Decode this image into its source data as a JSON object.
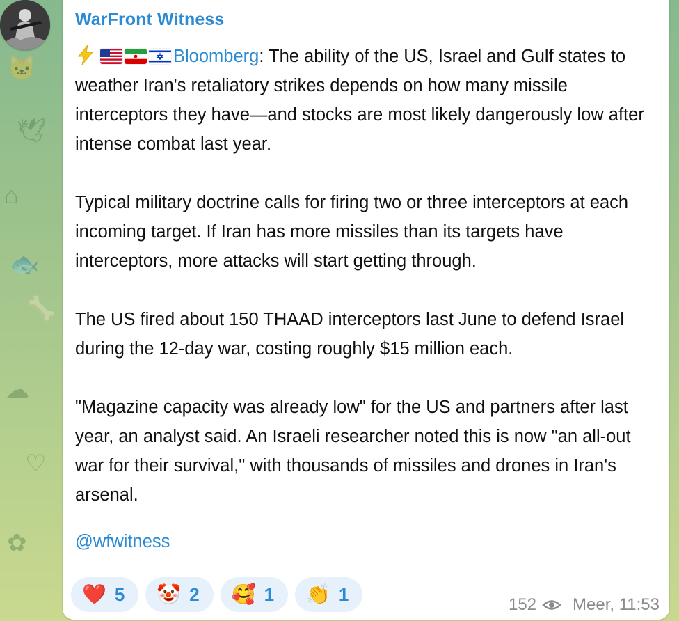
{
  "channel": {
    "name": "WarFront Witness"
  },
  "message": {
    "emoji_icons": [
      "lightning-icon",
      "us-flag-icon",
      "iran-flag-icon",
      "israel-flag-icon"
    ],
    "source_link": "Bloomberg",
    "intro_text": ": The ability of the US, Israel and Gulf states to weather Iran's retaliatory strikes depends on how many missile interceptors they have—and stocks are most likely dangerously low after intense combat last year.",
    "paragraphs": [
      "Typical military doctrine calls for firing two or three interceptors at each incoming target. If Iran has more missiles than its targets have interceptors, more attacks will start getting through.",
      "The US fired about 150 THAAD interceptors last June to defend Israel during the 12-day war, costing roughly $15 million each.",
      "\"Magazine capacity was already low\" for the US and partners after last year, an analyst said. An Israeli researcher noted this is now \"an all-out war for their survival,\" with thousands of missiles and drones in Iran's arsenal."
    ],
    "handle": "@wfwitness"
  },
  "reactions": [
    {
      "emoji": "❤️",
      "icon": "red-heart-icon",
      "count": "5"
    },
    {
      "emoji": "🤡",
      "icon": "clown-face-icon",
      "count": "2"
    },
    {
      "emoji": "🥰",
      "icon": "smiling-face-with-hearts-icon",
      "count": "1"
    },
    {
      "emoji": "👏",
      "icon": "clapping-hands-icon",
      "count": "1"
    }
  ],
  "meta": {
    "views": "152",
    "time": "Meer, 11:53"
  },
  "colors": {
    "accent": "#2b8ad1",
    "reaction_bg": "#e6f1fb",
    "meta_text": "#8a8a8a",
    "background_top": "#86b98e",
    "background_bottom": "#c9d98f"
  }
}
